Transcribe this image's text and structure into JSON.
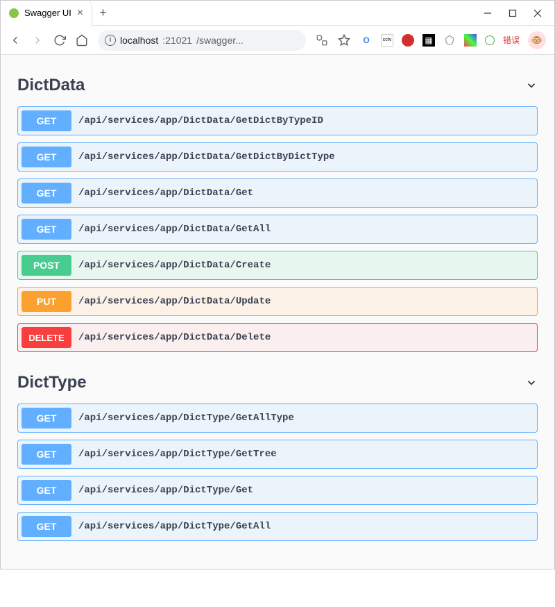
{
  "browser": {
    "tab_title": "Swagger UI",
    "url_host": "localhost",
    "url_port": ":21021",
    "url_path": "/swagger...",
    "error_badge": "错误"
  },
  "sections": [
    {
      "name": "DictData",
      "endpoints": [
        {
          "method": "GET",
          "path": "/api/services/app/DictData/GetDictByTypeID"
        },
        {
          "method": "GET",
          "path": "/api/services/app/DictData/GetDictByDictType"
        },
        {
          "method": "GET",
          "path": "/api/services/app/DictData/Get"
        },
        {
          "method": "GET",
          "path": "/api/services/app/DictData/GetAll"
        },
        {
          "method": "POST",
          "path": "/api/services/app/DictData/Create"
        },
        {
          "method": "PUT",
          "path": "/api/services/app/DictData/Update"
        },
        {
          "method": "DELETE",
          "path": "/api/services/app/DictData/Delete"
        }
      ]
    },
    {
      "name": "DictType",
      "endpoints": [
        {
          "method": "GET",
          "path": "/api/services/app/DictType/GetAllType"
        },
        {
          "method": "GET",
          "path": "/api/services/app/DictType/GetTree"
        },
        {
          "method": "GET",
          "path": "/api/services/app/DictType/Get"
        },
        {
          "method": "GET",
          "path": "/api/services/app/DictType/GetAll"
        }
      ]
    }
  ]
}
